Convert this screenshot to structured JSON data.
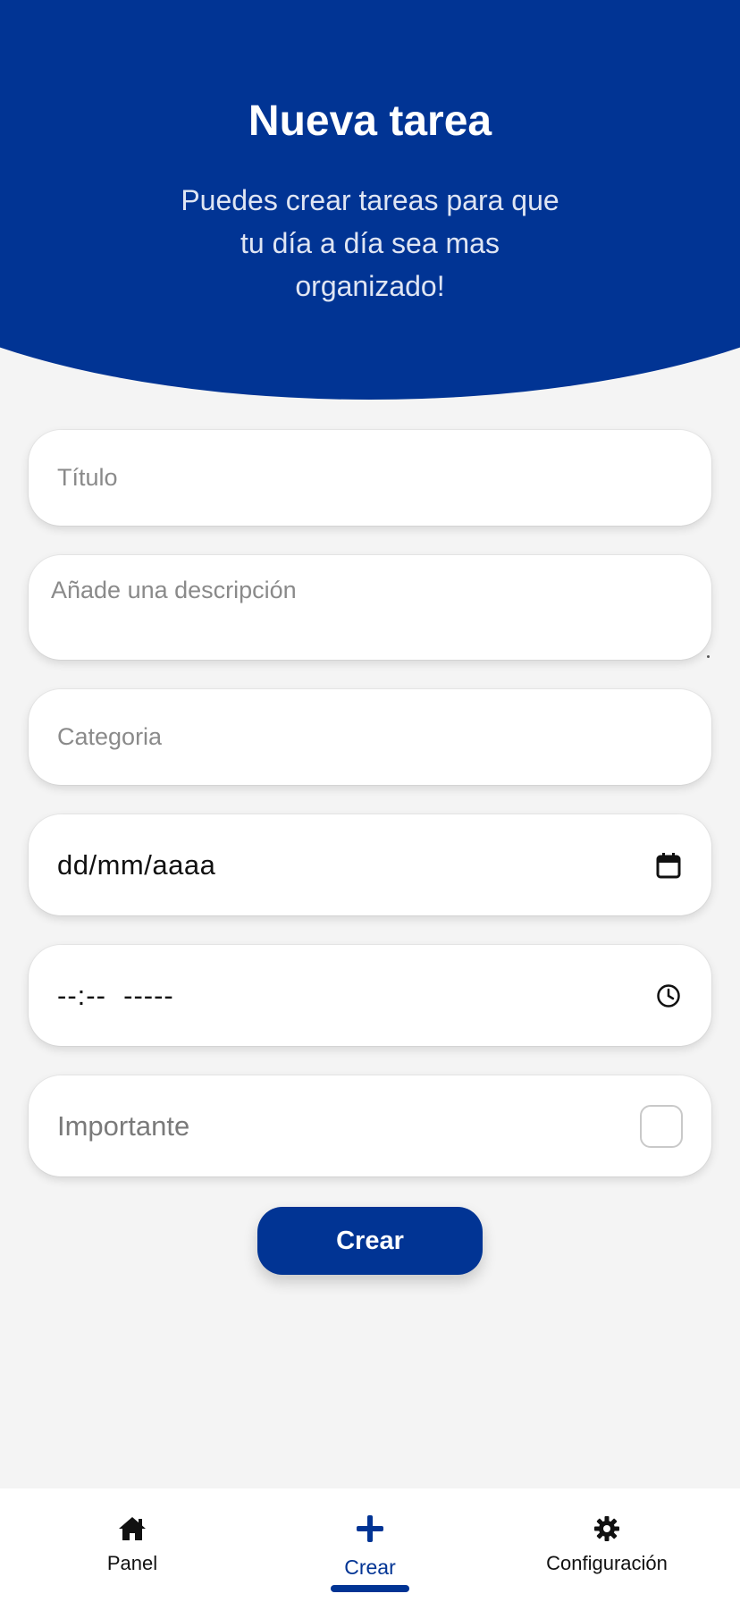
{
  "header": {
    "title": "Nueva tarea",
    "subtitle": "Puedes crear tareas para que tu día a día sea mas organizado!"
  },
  "form": {
    "title_placeholder": "Título",
    "description_placeholder": "Añade una descripción",
    "category_placeholder": "Categoria",
    "date_value": "dd/mm/aaaa",
    "time_value": "--:--  -----",
    "important_label": "Importante",
    "important_checked": false,
    "create_label": "Crear"
  },
  "nav": {
    "items": [
      {
        "label": "Panel",
        "icon": "home-icon"
      },
      {
        "label": "Crear",
        "icon": "plus-icon",
        "active": true
      },
      {
        "label": "Configuración",
        "icon": "gear-icon"
      }
    ]
  },
  "colors": {
    "primary": "#013494",
    "background": "#f4f4f4"
  }
}
